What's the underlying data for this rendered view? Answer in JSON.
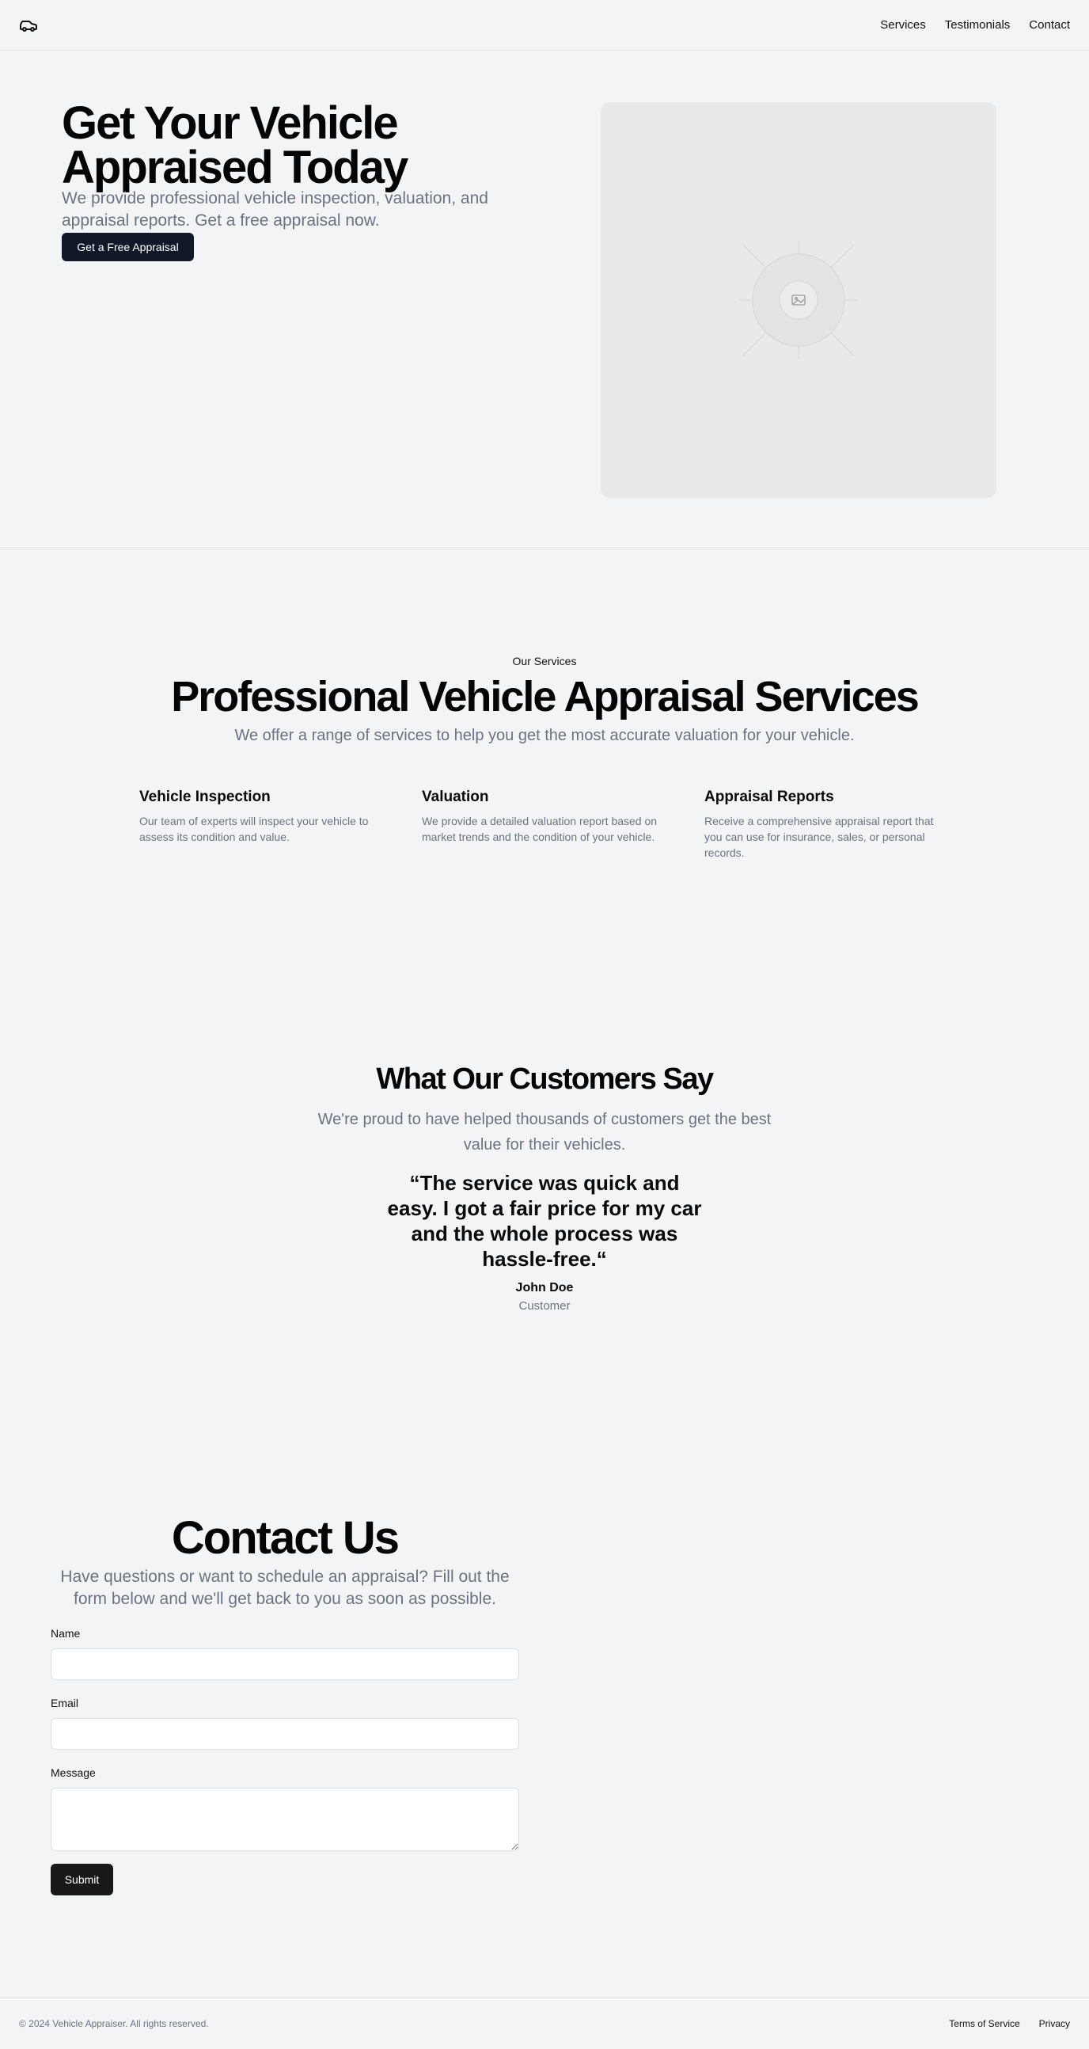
{
  "header": {
    "logo_icon": "car-icon",
    "nav": [
      "Services",
      "Testimonials",
      "Contact"
    ]
  },
  "hero": {
    "title": "Get Your Vehicle Appraised Today",
    "subtitle": "We provide professional vehicle inspection, valuation, and appraisal reports. Get a free appraisal now.",
    "cta": "Get a Free Appraisal",
    "image_icon": "image-placeholder-icon"
  },
  "services": {
    "eyebrow": "Our Services",
    "title": "Professional Vehicle Appraisal Services",
    "subtitle": "We offer a range of services to help you get the most accurate valuation for your vehicle.",
    "items": [
      {
        "title": "Vehicle Inspection",
        "text": "Our team of experts will inspect your vehicle to assess its condition and value."
      },
      {
        "title": "Valuation",
        "text": "We provide a detailed valuation report based on market trends and the condition of your vehicle."
      },
      {
        "title": "Appraisal Reports",
        "text": "Receive a comprehensive appraisal report that you can use for insurance, sales, or personal records."
      }
    ]
  },
  "testimonials": {
    "title": "What Our Customers Say",
    "subtitle": "We're proud to have helped thousands of customers get the best value for their vehicles.",
    "quote": "“The service was quick and easy. I got a fair price for my car and the whole process was hassle-free.“",
    "name": "John Doe",
    "role": "Customer"
  },
  "contact": {
    "title": "Contact Us",
    "subtitle": "Have questions or want to schedule an appraisal? Fill out the form below and we'll get back to you as soon as possible.",
    "name_label": "Name",
    "name_value": "",
    "email_label": "Email",
    "email_value": "",
    "message_label": "Message",
    "message_value": "",
    "submit": "Submit"
  },
  "footer": {
    "copyright": "© 2024 Vehicle Appraiser. All rights reserved.",
    "links": [
      "Terms of Service",
      "Privacy"
    ]
  },
  "colors": {
    "background": "#f3f4f6",
    "primary_button": "#111827",
    "muted_text": "#6b7280",
    "placeholder_bg": "#e9e9e9"
  }
}
